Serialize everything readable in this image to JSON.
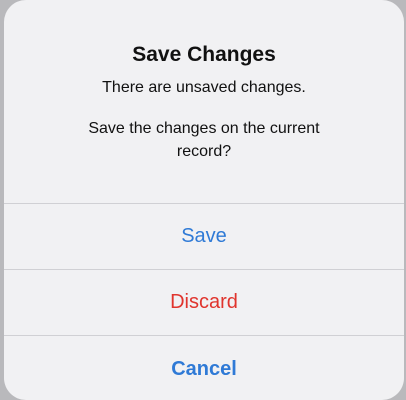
{
  "dialog": {
    "title": "Save Changes",
    "subtitle": "There are unsaved changes.",
    "message": "Save the changes on the current record?",
    "actions": [
      {
        "label": "Save",
        "color": "#2f7ad6",
        "style": "default"
      },
      {
        "label": "Discard",
        "color": "#e0342d",
        "style": "destructive"
      },
      {
        "label": "Cancel",
        "color": "#2f7ad6",
        "style": "cancel"
      }
    ]
  }
}
